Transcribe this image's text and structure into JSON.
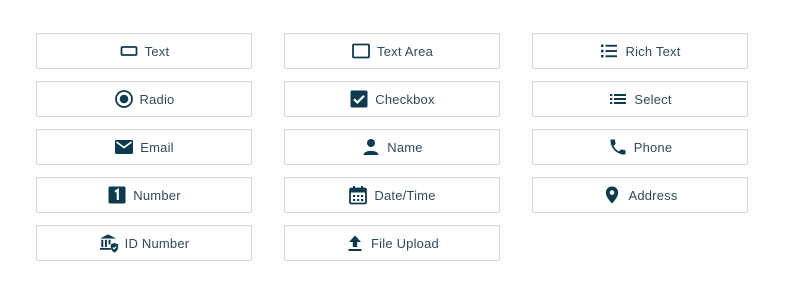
{
  "colors": {
    "icon": "#0e3a4f",
    "text": "#2f4b5c",
    "border": "#d3d7dc"
  },
  "fields": {
    "text": {
      "label": "Text",
      "icon": "text-input-icon"
    },
    "text_area": {
      "label": "Text Area",
      "icon": "text-area-icon"
    },
    "rich_text": {
      "label": "Rich Text",
      "icon": "list-icon"
    },
    "radio": {
      "label": "Radio",
      "icon": "radio-icon"
    },
    "checkbox": {
      "label": "Checkbox",
      "icon": "checkbox-icon"
    },
    "select": {
      "label": "Select",
      "icon": "list-icon"
    },
    "email": {
      "label": "Email",
      "icon": "envelope-icon"
    },
    "name": {
      "label": "Name",
      "icon": "person-icon"
    },
    "phone": {
      "label": "Phone",
      "icon": "phone-icon"
    },
    "number": {
      "label": "Number",
      "icon": "number-one-icon"
    },
    "datetime": {
      "label": "Date/Time",
      "icon": "calendar-icon"
    },
    "address": {
      "label": "Address",
      "icon": "map-pin-icon"
    },
    "id_number": {
      "label": "ID Number",
      "icon": "bank-shield-icon"
    },
    "file_upload": {
      "label": "File Upload",
      "icon": "upload-icon"
    }
  }
}
